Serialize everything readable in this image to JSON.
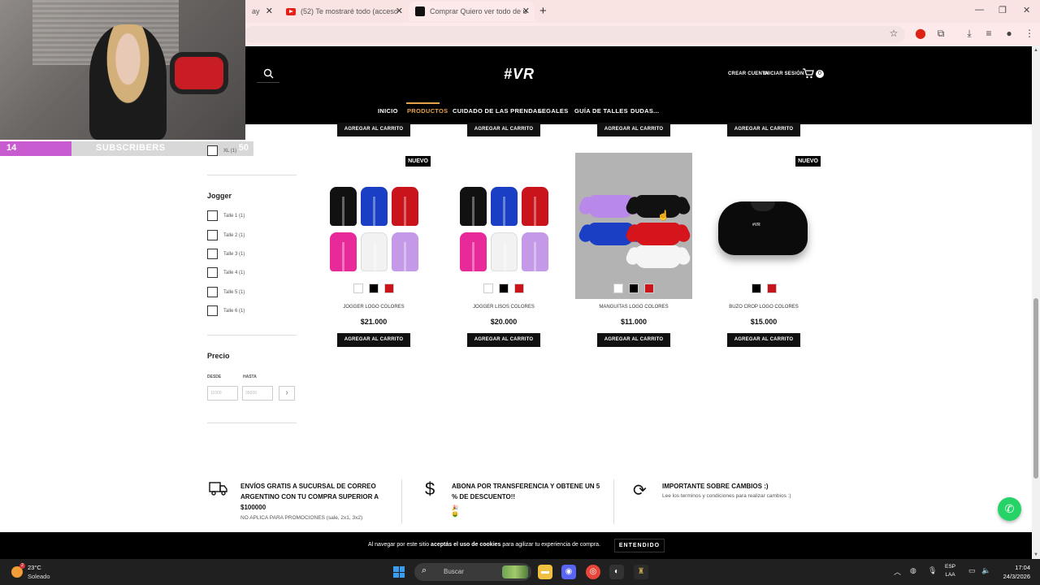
{
  "browser": {
    "tabs": [
      {
        "label": "ay",
        "active": false
      },
      {
        "label": "(52) Te mostraré todo (acceso",
        "active": false
      },
      {
        "label": "Comprar Quiero ver todo de u",
        "active": true
      }
    ]
  },
  "stream": {
    "subscriber_count": "14",
    "subscriber_label": "SUBSCRIBERS",
    "subscriber_goal": "50"
  },
  "site": {
    "logo": "#VR",
    "create_account": "CREAR CUENTA",
    "login": "INICIAR SESIÓN",
    "cart_count": "0",
    "nav": [
      "INICIO",
      "PRODUCTOS",
      "CUIDADO DE LAS PRENDAS",
      "LEGALES",
      "GUÍA DE TALLES",
      "DUDAS..."
    ]
  },
  "filters": {
    "xl_label": "XL (1)",
    "jogger_heading": "Jogger",
    "jogger_sizes": [
      "Talle 1 (1)",
      "Talle 2 (1)",
      "Talle 3 (1)",
      "Talle 4 (1)",
      "Talle 5 (1)",
      "Talle 6 (1)"
    ],
    "price_heading": "Precio",
    "from_label": "DESDE",
    "to_label": "HASTA",
    "from_placeholder": "11000",
    "to_placeholder": "35000",
    "go": "›"
  },
  "products": {
    "add_to_cart": "AGREGAR AL CARRITO",
    "badge_new": "NUEVO",
    "items": [
      {
        "name": "JOGGER LOGO COLORES",
        "price": "$21.000",
        "is_new": true
      },
      {
        "name": "JOGGER LISOS COLORES",
        "price": "$20.000",
        "is_new": false
      },
      {
        "name": "MANGUITAS LOGO COLORES",
        "price": "$11.000",
        "is_new": false
      },
      {
        "name": "BUZO CROP LOGO COLORES",
        "price": "$15.000",
        "is_new": true
      }
    ],
    "crop_print": "#VR"
  },
  "info": {
    "shipping_title": "ENVÍOS GRATIS A SUCURSAL DE CORREO ARGENTINO CON TU COMPRA SUPERIOR A $100000",
    "shipping_sub": "NO APLICA PARA PROMOCIONES (sale, 2x1, 3x2)",
    "transfer_title": "ABONA POR TRANSFERENCIA Y OBTENE UN 5 % DE DESCUENTO!!",
    "transfer_sub": "🎉 🤑",
    "changes_title": "IMPORTANTE SOBRE CAMBIOS :)",
    "changes_sub": "Lee los terminos y condiciones para realizar cambios :)"
  },
  "cookie": {
    "msg_pre": "Al navegar por este sitio ",
    "msg_bold": "aceptás el uso de cookies",
    "msg_post": " para agilizar tu experiencia de compra.",
    "button": "ENTENDIDO"
  },
  "taskbar": {
    "temperature": "23°C",
    "condition": "Soleado",
    "weather_badge": "2",
    "search": "Buscar",
    "lang1": "ESP",
    "lang2": "LAA",
    "time": "17:04",
    "date": "24/3/2026"
  },
  "colors": {
    "accent": "#e6a14b",
    "header_bg": "#000000",
    "whatsapp": "#25d366",
    "subscriber_bar": "#c95bd0"
  }
}
